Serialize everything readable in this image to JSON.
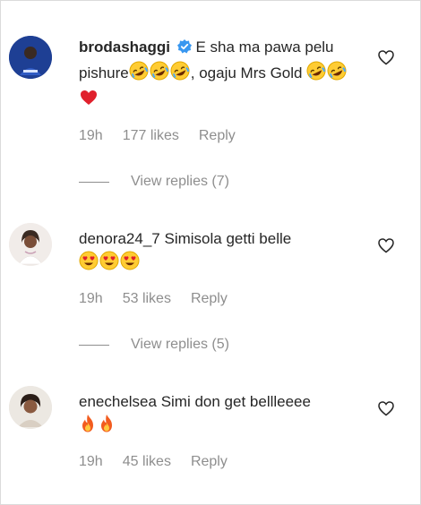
{
  "comments": [
    {
      "username": "brodashaggi",
      "text": " E sha ma pawa pelu pishure",
      "text_after": ", ogaju Mrs Gold ",
      "emojis_inline": [
        "rolling-laughing",
        "rolling-laughing",
        "rolling-laughing"
      ],
      "emojis_end": [
        "rolling-laughing",
        "rolling-laughing",
        "red-heart"
      ],
      "verified": true,
      "time": "19h",
      "likes": "177 likes",
      "reply_label": "Reply",
      "view_replies": "View replies (7)"
    },
    {
      "username": "denora24_7",
      "text": " Simisola getti belle",
      "emojis_end": [
        "heart-eyes",
        "heart-eyes",
        "heart-eyes"
      ],
      "time": "19h",
      "likes": "53 likes",
      "reply_label": "Reply",
      "view_replies": "View replies (5)"
    },
    {
      "username": "enechelsea",
      "text": " Simi don get bellleeee",
      "emojis_end": [
        "fire",
        "fire"
      ],
      "time": "19h",
      "likes": "45 likes",
      "reply_label": "Reply"
    }
  ],
  "colors": {
    "text": "#262626",
    "muted": "#8e8e8e",
    "verified": "#3897f0",
    "border": "#dbdbdb"
  }
}
